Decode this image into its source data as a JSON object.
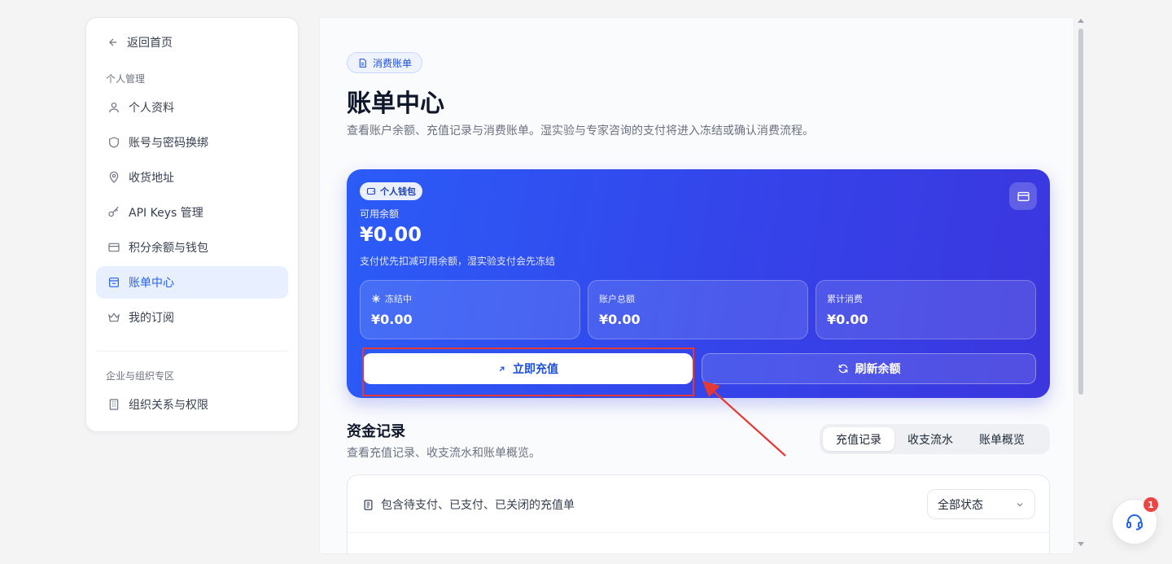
{
  "sidebar": {
    "back_label": "返回首页",
    "section_personal": "个人管理",
    "items": [
      {
        "label": "个人资料",
        "icon": "user-icon"
      },
      {
        "label": "账号与密码换绑",
        "icon": "shield-icon"
      },
      {
        "label": "收货地址",
        "icon": "location-pin-icon"
      },
      {
        "label": "API Keys 管理",
        "icon": "key-icon"
      },
      {
        "label": "积分余额与钱包",
        "icon": "card-icon"
      },
      {
        "label": "账单中心",
        "icon": "bill-icon",
        "active": true
      },
      {
        "label": "我的订阅",
        "icon": "crown-icon"
      }
    ],
    "section_enterprise": "企业与组织专区",
    "enterprise_items": [
      {
        "label": "组织关系与权限",
        "icon": "building-icon"
      }
    ]
  },
  "header": {
    "tag": "消费账单",
    "title": "账单中心",
    "description": "查看账户余额、充值记录与消费账单。湿实验与专家咨询的支付将进入冻结或确认消费流程。"
  },
  "wallet": {
    "tag": "个人钱包",
    "available_label": "可用余额",
    "available_value": "¥0.00",
    "note": "支付优先扣减可用余额，湿实验支付会先冻结",
    "stats": [
      {
        "label": "冻结中",
        "value": "¥0.00",
        "icon": "snowflake-icon"
      },
      {
        "label": "账户总额",
        "value": "¥0.00"
      },
      {
        "label": "累计消费",
        "value": "¥0.00"
      }
    ],
    "recharge_label": "立即充值",
    "refresh_label": "刷新余额"
  },
  "records": {
    "title": "资金记录",
    "description": "查看充值记录、收支流水和账单概览。",
    "tabs": [
      "充值记录",
      "收支流水",
      "账单概览"
    ],
    "active_tab": "充值记录",
    "note": "包含待支付、已支付、已关闭的充值单",
    "status_filter": "全部状态"
  },
  "support": {
    "badge": "1"
  },
  "colors": {
    "accent": "#2563eb",
    "wallet_gradient_start": "#2b5cf7",
    "wallet_gradient_end": "#3b36de",
    "highlight": "#e53935",
    "badge": "#ef4444"
  }
}
